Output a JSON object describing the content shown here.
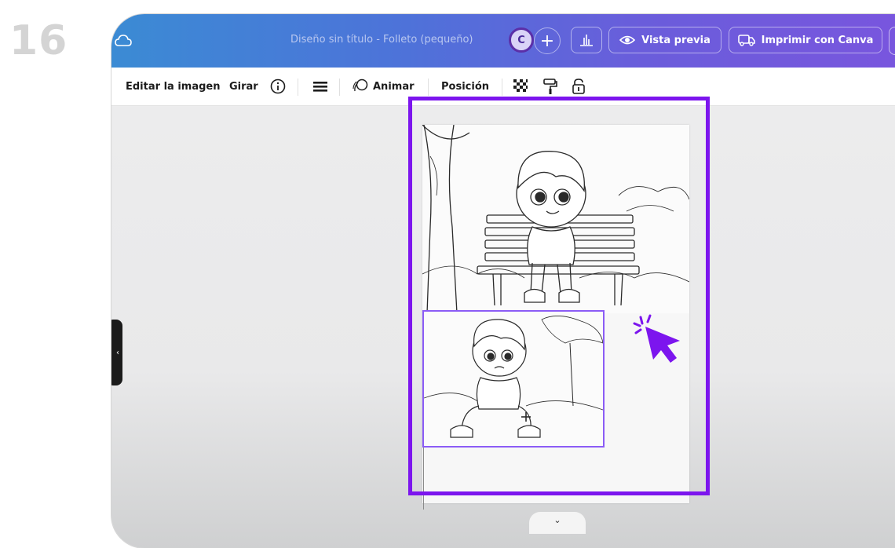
{
  "step": {
    "number": "16"
  },
  "header": {
    "document_title": "Diseño sin título - Folleto (pequeño)",
    "avatar_initial": "C",
    "add_label": "+",
    "preview_label": "Vista previa",
    "print_label": "Imprimir con Canva"
  },
  "toolbar": {
    "edit_image": "Editar la imagen",
    "rotate": "Girar",
    "animate": "Animar",
    "position": "Posición"
  },
  "icons": {
    "cloud": "cloud-icon",
    "stats": "bar-chart-icon",
    "eye": "eye-icon",
    "truck": "truck-icon",
    "info": "info-icon",
    "menu": "hamburger-icon",
    "animate": "animate-icon",
    "transparency": "transparency-icon",
    "paint_roller": "paint-roller-icon",
    "lock": "lock-icon",
    "cursor": "click-cursor-icon"
  },
  "colors": {
    "highlight": "#7c15ee",
    "selection": "#8b5cf6",
    "topbar_start": "#3b8bd4",
    "topbar_end": "#7a55de"
  }
}
